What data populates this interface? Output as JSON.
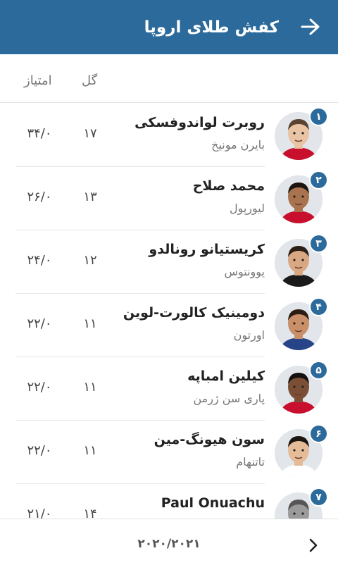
{
  "header": {
    "title": "کفش طلای اروپا",
    "back_icon": "arrow-right-icon",
    "bg_color": "#2b6a9b"
  },
  "columns": {
    "goals": "گل",
    "points": "امتیاز"
  },
  "players": [
    {
      "rank": "۱",
      "name": "روبرت لواندوفسکی",
      "team": "بایرن مونیخ",
      "goals": "۱۷",
      "points": "۳۴/۰",
      "skin": "#e8c3a4",
      "hair": "#5a4330",
      "shirt": "#c8102e"
    },
    {
      "rank": "۲",
      "name": "محمد صلاح",
      "team": "لیورپول",
      "goals": "۱۳",
      "points": "۲۶/۰",
      "skin": "#a8734e",
      "hair": "#1d1410",
      "shirt": "#c8102e"
    },
    {
      "rank": "۳",
      "name": "کریستیانو رونالدو",
      "team": "یوونتوس",
      "goals": "۱۲",
      "points": "۲۴/۰",
      "skin": "#d9a883",
      "hair": "#2a1e16",
      "shirt": "#1a1a1a"
    },
    {
      "rank": "۴",
      "name": "دومینیک کالورت-لوین",
      "team": "اورتون",
      "goals": "۱۱",
      "points": "۲۲/۰",
      "skin": "#c98f68",
      "hair": "#2b1d14",
      "shirt": "#274488"
    },
    {
      "rank": "۵",
      "name": "کیلین امباپه",
      "team": "پاری سن ژرمن",
      "goals": "۱۱",
      "points": "۲۲/۰",
      "skin": "#7a4f35",
      "hair": "#151010",
      "shirt": "#c8102e"
    },
    {
      "rank": "۶",
      "name": "سون هیونگ-مین",
      "team": "تاتنهام",
      "goals": "۱۱",
      "points": "۲۲/۰",
      "skin": "#e4bd98",
      "hair": "#1b1612",
      "shirt": "#ffffff"
    },
    {
      "rank": "۷",
      "name": "Paul Onuachu",
      "team": "",
      "goals": "۱۴",
      "points": "۲۱/۰",
      "skin": "#9a9a9a",
      "hair": "#555555",
      "shirt": "#777777"
    }
  ],
  "footer": {
    "season": "۲۰۲۰/۲۰۲۱",
    "next_icon": "chevron-right-icon"
  }
}
